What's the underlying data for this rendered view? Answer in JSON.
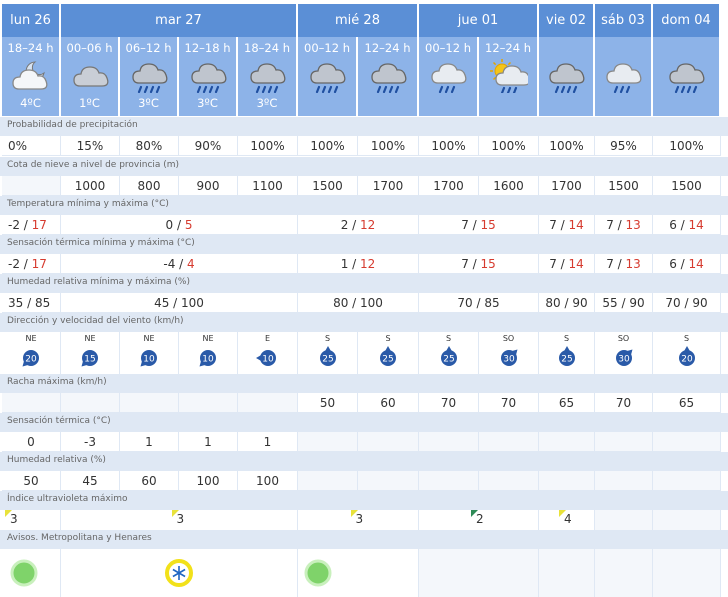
{
  "days": [
    {
      "label": "lun 26",
      "periods": [
        {
          "time": "18–24 h",
          "icon": "partly-cloudy-night-icon",
          "temp": "4ºC"
        }
      ]
    },
    {
      "label": "mar 27",
      "periods": [
        {
          "time": "00–06 h",
          "icon": "cloudy-icon",
          "temp": "1ºC"
        },
        {
          "time": "06–12 h",
          "icon": "rain-icon",
          "temp": "3ºC"
        },
        {
          "time": "12–18 h",
          "icon": "rain-icon",
          "temp": "3ºC"
        },
        {
          "time": "18–24 h",
          "icon": "rain-icon",
          "temp": "3ºC"
        }
      ]
    },
    {
      "label": "mié 28",
      "periods": [
        {
          "time": "00–12 h",
          "icon": "rain-icon",
          "temp": ""
        },
        {
          "time": "12–24 h",
          "icon": "rain-icon",
          "temp": ""
        }
      ]
    },
    {
      "label": "jue 01",
      "periods": [
        {
          "time": "00–12 h",
          "icon": "light-rain-icon",
          "temp": ""
        },
        {
          "time": "12–24 h",
          "icon": "sun-rain-icon",
          "temp": ""
        }
      ]
    },
    {
      "label": "vie 02",
      "periods": [
        {
          "time": "",
          "icon": "rain-icon",
          "temp": ""
        }
      ]
    },
    {
      "label": "sáb 03",
      "periods": [
        {
          "time": "",
          "icon": "light-rain-icon",
          "temp": ""
        }
      ]
    },
    {
      "label": "dom 04",
      "periods": [
        {
          "time": "",
          "icon": "rain-icon",
          "temp": ""
        }
      ]
    }
  ],
  "rows": {
    "precip": {
      "label": "Probabilidad de precipitación",
      "values": [
        "0%",
        "15%",
        "80%",
        "90%",
        "100%",
        "100%",
        "100%",
        "100%",
        "100%",
        "100%",
        "95%",
        "100%"
      ]
    },
    "snow": {
      "label": "Cota de nieve a nivel de provincia (m)",
      "values": [
        "",
        "1000",
        "800",
        "900",
        "1100",
        "1500",
        "1700",
        "1700",
        "1600",
        "1700",
        "1500",
        "1500"
      ]
    },
    "temp_minmax": {
      "label": "Temperatura mínima y máxima (°C)",
      "values": [
        [
          "-2",
          "17"
        ],
        [
          "0",
          "5"
        ],
        [
          "2",
          "12"
        ],
        [
          "7",
          "15"
        ],
        [
          "7",
          "14"
        ],
        [
          "7",
          "13"
        ],
        [
          "6",
          "14"
        ]
      ]
    },
    "feels_minmax": {
      "label": "Sensación térmica mínima y máxima (°C)",
      "values": [
        [
          "-2",
          "17"
        ],
        [
          "-4",
          "4"
        ],
        [
          "1",
          "12"
        ],
        [
          "7",
          "15"
        ],
        [
          "7",
          "14"
        ],
        [
          "7",
          "13"
        ],
        [
          "6",
          "14"
        ]
      ]
    },
    "humidity_minmax": {
      "label": "Humedad relativa mínima y máxima (%)",
      "values": [
        "35 / 85",
        "45 / 100",
        "80 / 100",
        "70 / 85",
        "80 / 90",
        "55 / 90",
        "70 / 90"
      ]
    },
    "wind": {
      "label": "Dirección y velocidad del viento (km/h)",
      "values": [
        {
          "dir": "NE",
          "speed": "20"
        },
        {
          "dir": "NE",
          "speed": "15"
        },
        {
          "dir": "NE",
          "speed": "10"
        },
        {
          "dir": "NE",
          "speed": "10"
        },
        {
          "dir": "E",
          "speed": "10"
        },
        {
          "dir": "S",
          "speed": "25"
        },
        {
          "dir": "S",
          "speed": "25"
        },
        {
          "dir": "S",
          "speed": "25"
        },
        {
          "dir": "SO",
          "speed": "30"
        },
        {
          "dir": "S",
          "speed": "25"
        },
        {
          "dir": "SO",
          "speed": "30"
        },
        {
          "dir": "S",
          "speed": "20"
        }
      ]
    },
    "gust": {
      "label": "Racha máxima (km/h)",
      "values": [
        "",
        "",
        "",
        "",
        "",
        "50",
        "60",
        "70",
        "70",
        "65",
        "70",
        "65"
      ]
    },
    "feels": {
      "label": "Sensación térmica (°C)",
      "values": [
        "0",
        "-3",
        "1",
        "1",
        "1",
        "",
        "",
        "",
        "",
        "",
        "",
        ""
      ]
    },
    "humidity": {
      "label": "Humedad relativa (%)",
      "values": [
        "50",
        "45",
        "60",
        "100",
        "100",
        "",
        "",
        "",
        "",
        "",
        "",
        ""
      ]
    },
    "uv": {
      "label": "Índice ultravioleta máximo",
      "values": [
        "3",
        "3",
        "3",
        "2",
        "4",
        "",
        ""
      ]
    },
    "warnings": {
      "label": "Avisos. Metropolitana y Henares"
    }
  },
  "colors": {
    "header": "#5b8fd6",
    "subheader": "#8db3e8",
    "label_bg": "#dfe8f4",
    "max_red": "#d63b2f",
    "wind_badge": "#2a5aa8",
    "warn_green": "#7fd36a",
    "warn_yellow": "#f2e11a",
    "uv_yellow": "#e8e23a",
    "uv_green": "#2e8b57"
  }
}
